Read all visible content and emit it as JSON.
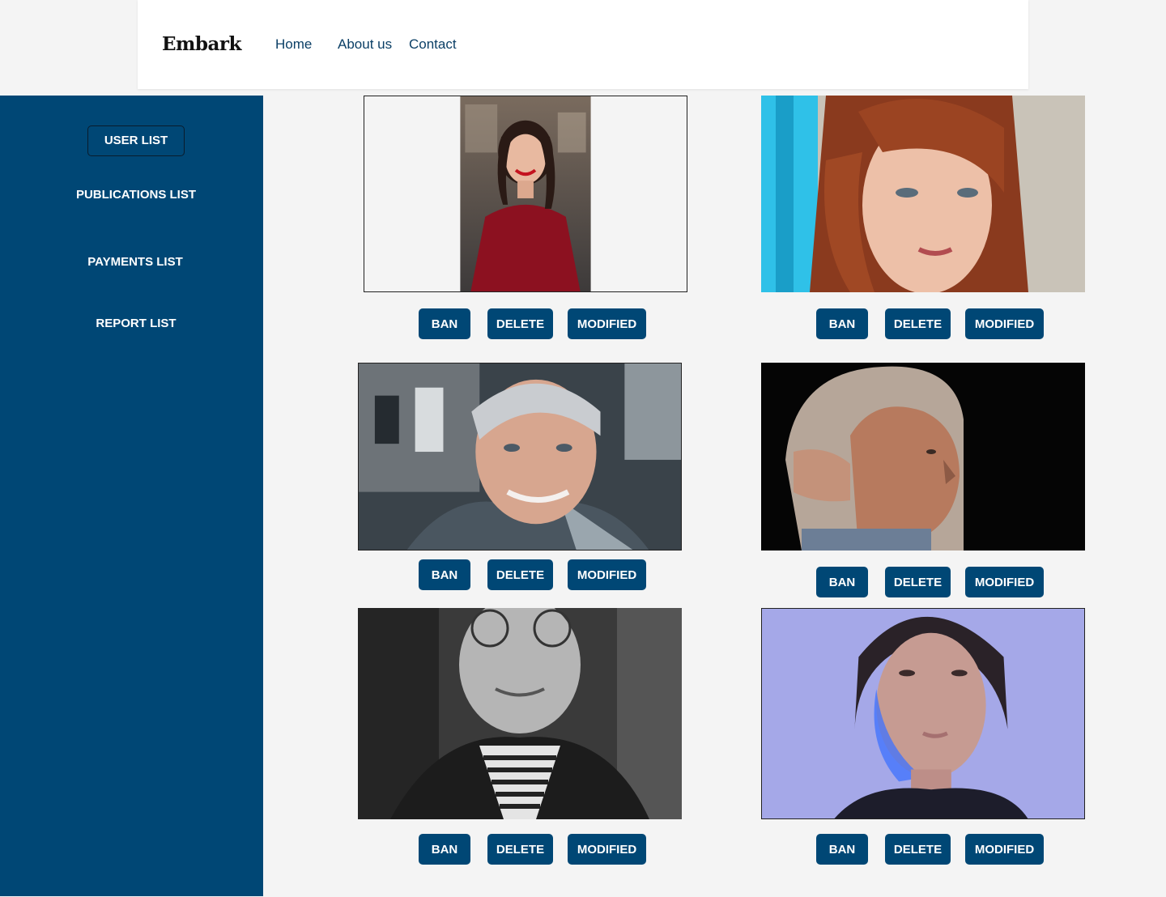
{
  "brand": {
    "name": "Embark"
  },
  "nav": {
    "home": "Home",
    "about": "About us",
    "contact": "Contact"
  },
  "sidebar": {
    "items": [
      {
        "label": "USER LIST"
      },
      {
        "label": "PUBLICATIONS LIST"
      },
      {
        "label": "PAYMENTS LIST"
      },
      {
        "label": "REPORT LIST"
      }
    ]
  },
  "actions": {
    "ban": "BAN",
    "delete": "DELETE",
    "modified": "MODIFIED"
  },
  "colors": {
    "primary": "#004775",
    "background": "#f4f4f4",
    "nav_text": "#0b3f66"
  }
}
